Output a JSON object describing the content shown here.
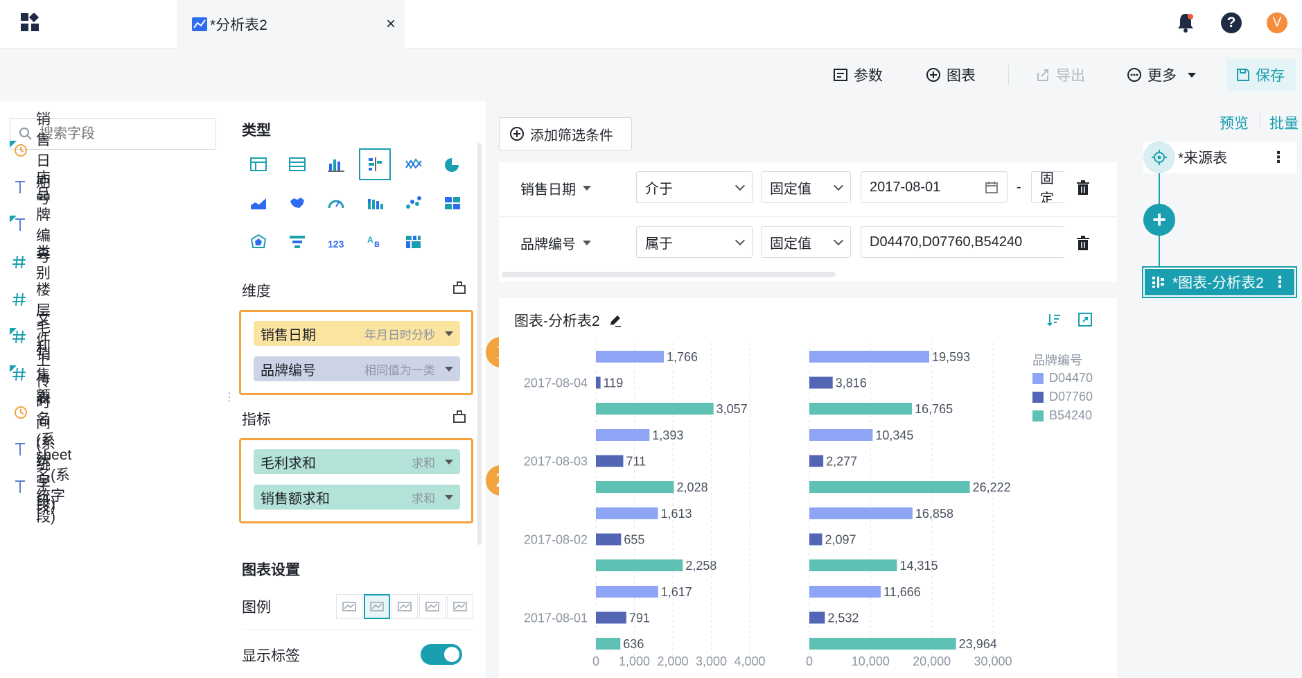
{
  "app": {
    "tab_title": "*分析表2"
  },
  "toolbar": {
    "params": "参数",
    "chart": "图表",
    "export": "导出",
    "more": "更多",
    "save": "保存"
  },
  "fields": {
    "search_placeholder": "搜索字段",
    "items": [
      {
        "label": "销售日期",
        "kind": "date"
      },
      {
        "label": "店号",
        "kind": "text"
      },
      {
        "label": "品牌编号",
        "kind": "text"
      },
      {
        "label": "类别",
        "kind": "number"
      },
      {
        "label": "楼层",
        "kind": "number"
      },
      {
        "label": "毛利",
        "kind": "number"
      },
      {
        "label": "销售额",
        "kind": "number"
      },
      {
        "label": "文件上传时间(系统字段)",
        "kind": "date"
      },
      {
        "label": "表名(系统字段)",
        "kind": "text"
      },
      {
        "label": "sheet名(系统字段)",
        "kind": "text"
      }
    ]
  },
  "config": {
    "type_title": "类型",
    "dim_title": "维度",
    "dims": [
      {
        "label": "销售日期",
        "sub": "年月日时分秒"
      },
      {
        "label": "品牌编号",
        "sub": "相同值为一类"
      }
    ],
    "metric_title": "指标",
    "metrics": [
      {
        "label": "毛利求和",
        "sub": "求和"
      },
      {
        "label": "销售额求和",
        "sub": "求和"
      }
    ],
    "settings_title": "图表设置",
    "legend_label": "图例",
    "show_labels": "显示标签",
    "badge1": "1",
    "badge2": "2"
  },
  "filters": {
    "add": "添加筛选条件",
    "row1": {
      "field": "销售日期",
      "op": "介于",
      "mode": "固定值",
      "value": "2017-08-01",
      "dash": "-",
      "mode2": "固定"
    },
    "row2": {
      "field": "品牌编号",
      "op": "属于",
      "mode": "固定值",
      "value": "D04470,D07760,B54240"
    }
  },
  "chart_card": {
    "title": "图表-分析表2"
  },
  "flow": {
    "source": "*来源表",
    "node": "*图表-分析表2",
    "preview": "预览",
    "batch": "批量"
  },
  "colors": {
    "D04470": "#8ea4f5",
    "D07760": "#5266b5",
    "B54240": "#5fc0b4",
    "accent": "#1a9fb0",
    "highlight": "#f2a33c"
  },
  "chart_data": {
    "type": "bar",
    "orientation": "horizontal",
    "categories": [
      "2017-08-04",
      "2017-08-03",
      "2017-08-02",
      "2017-08-01"
    ],
    "legend_title": "品牌编号",
    "legend_placement": "right",
    "panels": [
      {
        "metric": "毛利求和",
        "xlim": [
          0,
          4000
        ],
        "ticks": [
          "0",
          "1,000",
          "2,000",
          "3,000",
          "4,000"
        ],
        "series": [
          {
            "name": "D04470",
            "values": [
              1766,
              1393,
              1613,
              1617
            ],
            "labels": [
              "1,766",
              "1,393",
              "1,613",
              "1,617"
            ]
          },
          {
            "name": "D07760",
            "values": [
              119,
              711,
              655,
              791
            ],
            "labels": [
              "119",
              "711",
              "655",
              "791"
            ]
          },
          {
            "name": "B54240",
            "values": [
              3057,
              2028,
              2258,
              636
            ],
            "labels": [
              "3,057",
              "2,028",
              "2,258",
              "636"
            ]
          }
        ]
      },
      {
        "metric": "销售额求和",
        "xlim": [
          0,
          30000
        ],
        "ticks": [
          "0",
          "10,000",
          "20,000",
          "30,000"
        ],
        "series": [
          {
            "name": "D04470",
            "values": [
              19593,
              10345,
              16858,
              11666
            ],
            "labels": [
              "19,593",
              "10,345",
              "16,858",
              "11,666"
            ]
          },
          {
            "name": "D07760",
            "values": [
              3816,
              2277,
              2097,
              2532
            ],
            "labels": [
              "3,816",
              "2,277",
              "2,097",
              "2,532"
            ]
          },
          {
            "name": "B54240",
            "values": [
              16765,
              26222,
              14315,
              23964
            ],
            "labels": [
              "16,765",
              "26,222",
              "14,315",
              "23,964"
            ]
          }
        ]
      }
    ]
  }
}
